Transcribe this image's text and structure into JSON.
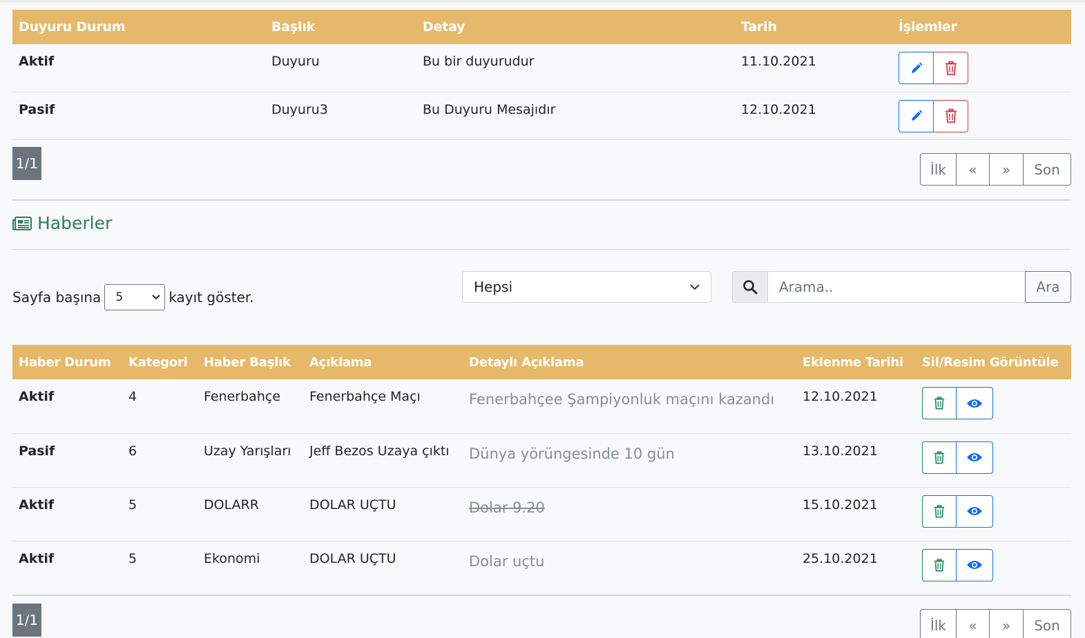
{
  "announcements": {
    "headers": [
      "Duyuru Durum",
      "Başlık",
      "Detay",
      "Tarih",
      "İşlemler"
    ],
    "rows": [
      {
        "status": "Aktif",
        "title": "Duyuru",
        "detail": "Bu bir duyurudur",
        "date": "11.10.2021"
      },
      {
        "status": "Pasif",
        "title": "Duyuru3",
        "detail": "Bu Duyuru Mesajıdır",
        "date": "12.10.2021"
      }
    ],
    "page_info": "1/1",
    "pager": {
      "first": "İlk",
      "prev": "«",
      "next": "»",
      "last": "Son"
    }
  },
  "news_section": {
    "title": "Haberler",
    "per_page": {
      "prefix": "Sayfa başına",
      "value": "5",
      "suffix": "kayıt göster."
    },
    "category_filter": "Hepsi",
    "search": {
      "placeholder": "Arama..",
      "button": "Ara"
    }
  },
  "news": {
    "headers": [
      "Haber Durum",
      "Kategori",
      "Haber Başlık",
      "Açıklama",
      "Detaylı Açıklama",
      "Eklenme Tarihi",
      "Sil/Resim Görüntüle"
    ],
    "rows": [
      {
        "status": "Aktif",
        "category": "4",
        "title": "Fenerbahçe",
        "description": "Fenerbahçe Maçı",
        "detail": "Fenerbahçee Şampiyonluk maçını kazandı",
        "date": "12.10.2021"
      },
      {
        "status": "Pasif",
        "category": "6",
        "title": "Uzay Yarışları",
        "description": "Jeff Bezos Uzaya çıktı",
        "detail": "Dünya yörüngesinde 10 gün",
        "date": "13.10.2021"
      },
      {
        "status": "Aktif",
        "category": "5",
        "title": "DOLARR",
        "description": "DOLAR UÇTU",
        "detail": "Dolar 9.20",
        "date": "15.10.2021"
      },
      {
        "status": "Aktif",
        "category": "5",
        "title": "Ekonomi",
        "description": "DOLAR UÇTU",
        "detail": "Dolar uçtu",
        "date": "25.10.2021"
      }
    ],
    "page_info": "1/1",
    "pager": {
      "first": "İlk",
      "prev": "«",
      "next": "»",
      "last": "Son"
    }
  },
  "colors": {
    "header_bg": "#e6b96a",
    "edit": "#0d6efd",
    "delete": "#dc3545",
    "green_delete": "#198754",
    "section_title": "#2e7d5b"
  }
}
